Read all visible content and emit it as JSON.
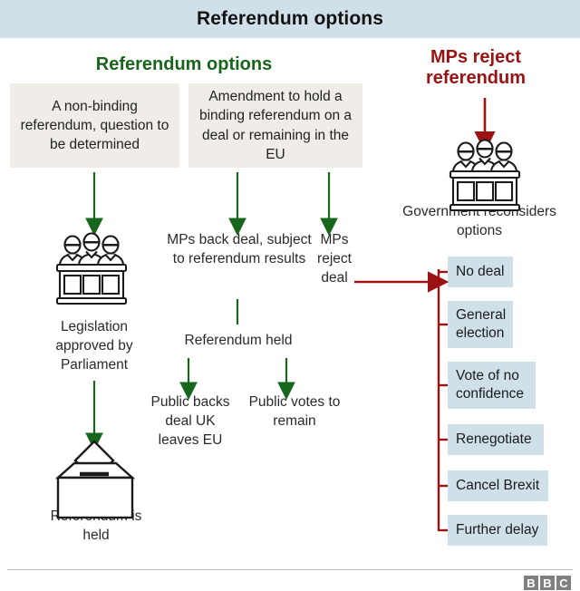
{
  "header": {
    "title": "Referendum options",
    "bar_color": "#cfe0e8"
  },
  "sections": {
    "left_heading": "Referendum options",
    "left_heading_color": "#18661b",
    "right_heading": "MPs reject referendum",
    "right_heading_color": "#9c1213"
  },
  "boxes": {
    "non_binding": "A non-binding referendum, question to be determined",
    "amendment": "Amendment to hold a binding referendum on a deal or remaining in the EU",
    "box_color": "#f0ede9"
  },
  "captions": {
    "mps_back_deal": "MPs back deal, subject to referendum results",
    "mps_reject_deal": "MPs reject deal",
    "legislation_approved": "Legislation approved by Parliament",
    "referendum_held": "Referendum held",
    "public_backs_deal": "Public backs deal UK leaves EU",
    "public_votes_remain": "Public votes to remain",
    "referendum_is_held": "Referendum is held",
    "government_reconsiders": "Government reconsiders options"
  },
  "options": {
    "box_color": "#cfe0e8",
    "connector_color": "#9c1213",
    "items": [
      {
        "label": "No deal"
      },
      {
        "label": "General election"
      },
      {
        "label": "Vote of no confidence"
      },
      {
        "label": "Renegotiate"
      },
      {
        "label": "Cancel Brexit"
      },
      {
        "label": "Further delay"
      }
    ]
  },
  "arrows": {
    "green_color": "#18661b",
    "red_color": "#9c1213"
  },
  "icons": {
    "parliament_left": "parliament-bench-icon",
    "parliament_right": "parliament-bench-icon",
    "ballot": "ballot-box-icon"
  },
  "footer": {
    "logo": [
      "B",
      "B",
      "C"
    ],
    "logo_color": "#808080"
  }
}
